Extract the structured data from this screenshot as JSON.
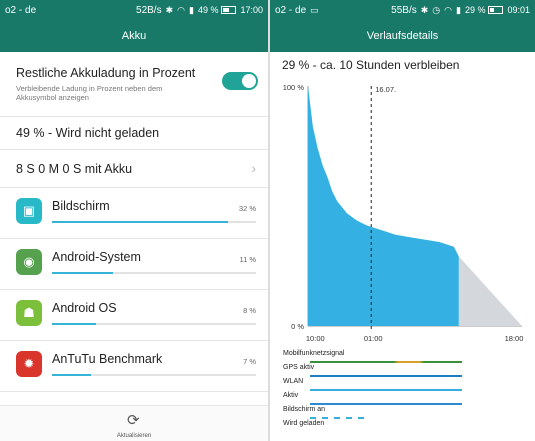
{
  "left": {
    "status": {
      "carrier": "o2 - de",
      "speed": "52B/s",
      "battery": "49 %",
      "battery_level": 0.49,
      "time": "17:00"
    },
    "title": "Akku",
    "setting": {
      "title": "Restliche Akkuladung in Prozent",
      "desc1": "Verbleibende Ladung in Prozent neben dem",
      "desc2": "Akkusymbol anzeigen",
      "enabled": true
    },
    "charge_status": "49 % - Wird nicht geladen",
    "on_battery": "8 S 0 M 0 S mit Akku",
    "apps": [
      {
        "name": "Bildschirm",
        "percent": "32 %",
        "level": 0.32,
        "color": "#28b9c8",
        "icon": "screen-icon"
      },
      {
        "name": "Android-System",
        "percent": "11 %",
        "level": 0.11,
        "color": "#55a14d",
        "icon": "android-system-icon"
      },
      {
        "name": "Android OS",
        "percent": "8 %",
        "level": 0.08,
        "color": "#7cbf3b",
        "icon": "android-icon"
      },
      {
        "name": "AnTuTu Benchmark",
        "percent": "7 %",
        "level": 0.07,
        "color": "#d9352b",
        "icon": "antutu-icon"
      }
    ],
    "refresh_label": "Aktualisieren"
  },
  "right": {
    "status": {
      "carrier": "o2 - de",
      "speed": "55B/s",
      "battery": "29 %",
      "battery_level": 0.29,
      "time": "09:01"
    },
    "title": "Verlaufsdetails",
    "summary": "29 % - ca. 10 Stunden verbleiben",
    "indicators": [
      {
        "label": "Mobilfunknetzsignal",
        "color": "#3a8f3a"
      },
      {
        "label": "GPS aktiv",
        "color": "#1d7fc4"
      },
      {
        "label": "WLAN",
        "color": "#37aee0"
      },
      {
        "label": "Aktiv",
        "color": "#2c8bd0"
      },
      {
        "label": "Bildschirm an",
        "color": "#37aee0"
      },
      {
        "label": "Wird geladen",
        "color": "#37aee0"
      }
    ]
  },
  "chart_data": {
    "type": "area",
    "title": "",
    "xlabel": "",
    "ylabel": "",
    "x_ticks": [
      "10:00",
      "01:00",
      "18:00"
    ],
    "y_ticks": [
      "100 %",
      "0 %"
    ],
    "ylim": [
      0,
      100
    ],
    "marker_label": "16.07.",
    "series": [
      {
        "x": [
          0,
          1,
          2,
          3,
          4,
          5,
          6,
          8,
          10,
          12,
          15,
          18,
          21,
          24,
          27,
          30,
          31
        ],
        "y": [
          100,
          83,
          74,
          67,
          62,
          56,
          52,
          47,
          44,
          42,
          40,
          38,
          37,
          36,
          35,
          33,
          29
        ]
      }
    ],
    "projection": {
      "from": [
        31,
        29
      ],
      "to": [
        44,
        0
      ]
    },
    "colors": {
      "actual": "#34b1e2",
      "projection": "#d4d8dc"
    }
  }
}
